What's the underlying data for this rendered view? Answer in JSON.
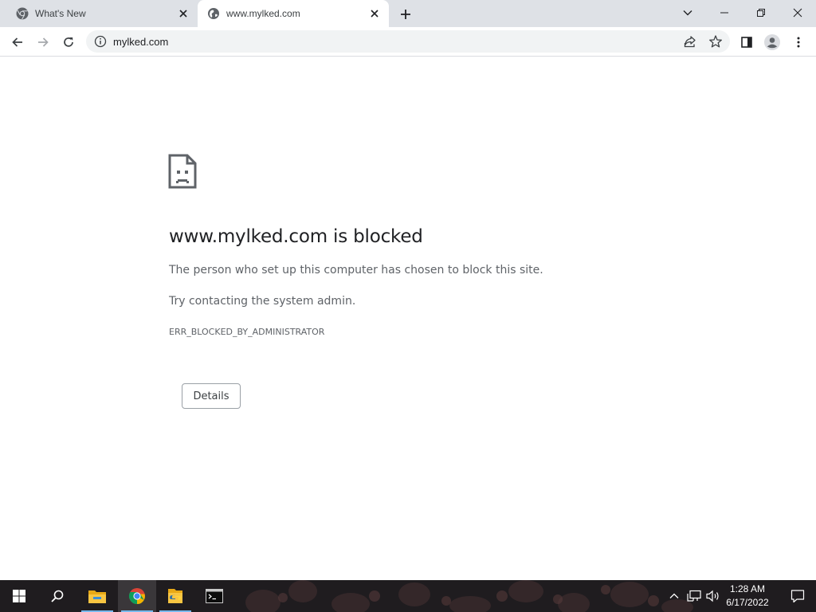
{
  "browser": {
    "tabs": [
      {
        "title": "What's New",
        "icon": "chrome-icon",
        "active": false
      },
      {
        "title": "www.mylked.com",
        "icon": "globe-icon",
        "active": true
      }
    ],
    "address_bar": {
      "url": "mylked.com",
      "icon": "info-icon"
    }
  },
  "error_page": {
    "icon": "sad-page-icon",
    "title": "www.mylked.com is blocked",
    "message": "The person who set up this computer has chosen to block this site.",
    "suggestion": "Try contacting the system admin.",
    "error_code": "ERR_BLOCKED_BY_ADMINISTRATOR",
    "details_button": "Details"
  },
  "taskbar": {
    "apps": [
      "start-icon",
      "search-icon",
      "file-explorer-icon",
      "chrome-icon",
      "python-icon",
      "terminal-icon"
    ],
    "clock": {
      "time": "1:28 AM",
      "date": "6/17/2022"
    }
  },
  "colors": {
    "tabstrip": "#dee1e6",
    "taskbar": "#1c1a1d",
    "accent": "#76b9ed"
  }
}
